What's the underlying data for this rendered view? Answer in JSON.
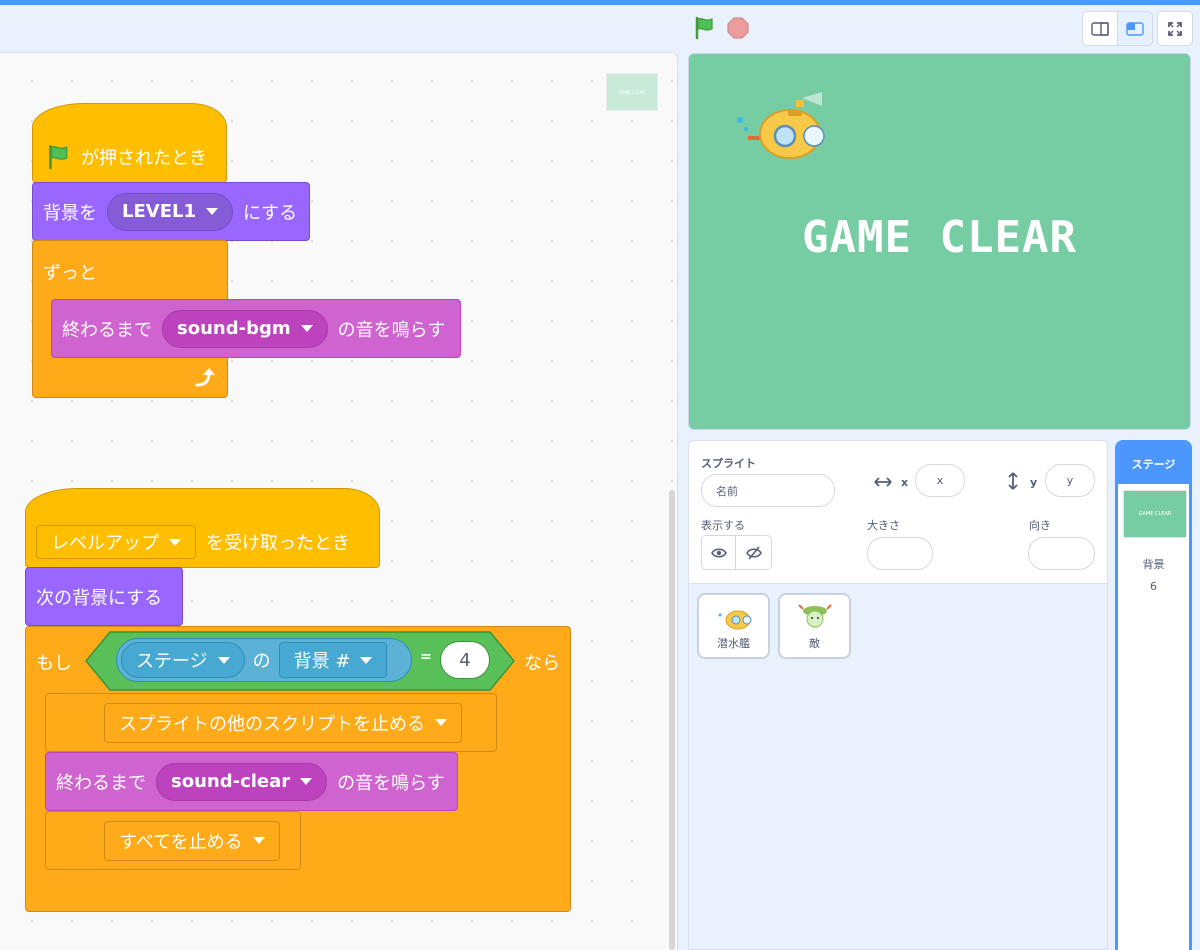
{
  "header": {
    "green_flag": "green-flag-icon",
    "stop": "stop-icon",
    "modes": [
      "small-stage-icon",
      "normal-stage-icon",
      "fullscreen-icon"
    ]
  },
  "colors": {
    "accent": "#4c97ff",
    "event": "#ffbf00",
    "looks": "#9966ff",
    "sound": "#cf63cf",
    "control": "#ffab19",
    "sensing": "#5cb1d6",
    "operator": "#59c059",
    "stage_bg": "#77cda3"
  },
  "code": {
    "minimap_text": "GAME CLEAR",
    "script1": {
      "hat": "が押されたとき",
      "switch_backdrop": {
        "prefix": "背景を",
        "value": "LEVEL1",
        "suffix": "にする"
      },
      "forever": "ずっと",
      "play_sound": {
        "prefix": "終わるまで",
        "value": "sound-bgm",
        "suffix": "の音を鳴らす"
      }
    },
    "script2": {
      "hat": {
        "value": "レベルアップ",
        "suffix": "を受け取ったとき"
      },
      "next_backdrop": "次の背景にする",
      "if": {
        "prefix": "もし",
        "sensing_target": "ステージ",
        "of": "の",
        "attribute": "背景 #",
        "equals": "=",
        "compare_value": "4",
        "suffix": "なら"
      },
      "stop_others": "スプライトの他のスクリプトを止める",
      "play_sound": {
        "prefix": "終わるまで",
        "value": "sound-clear",
        "suffix": "の音を鳴らす"
      },
      "stop_all": "すべてを止める"
    }
  },
  "stage": {
    "text": "GAME CLEAR"
  },
  "sprite_info": {
    "sprite_label": "スプライト",
    "name_placeholder": "名前",
    "x_label": "x",
    "x_placeholder": "x",
    "y_label": "y",
    "y_placeholder": "y",
    "show_label": "表示する",
    "size_label": "大きさ",
    "direction_label": "向き"
  },
  "sprites": [
    {
      "name": "潜水艦",
      "icon": "submarine-icon"
    },
    {
      "name": "敵",
      "icon": "enemy-icon"
    }
  ],
  "stage_pane": {
    "header": "ステージ",
    "backdrop_label": "背景",
    "backdrop_count": "6",
    "thumb_text": "GAME CLEAR"
  }
}
